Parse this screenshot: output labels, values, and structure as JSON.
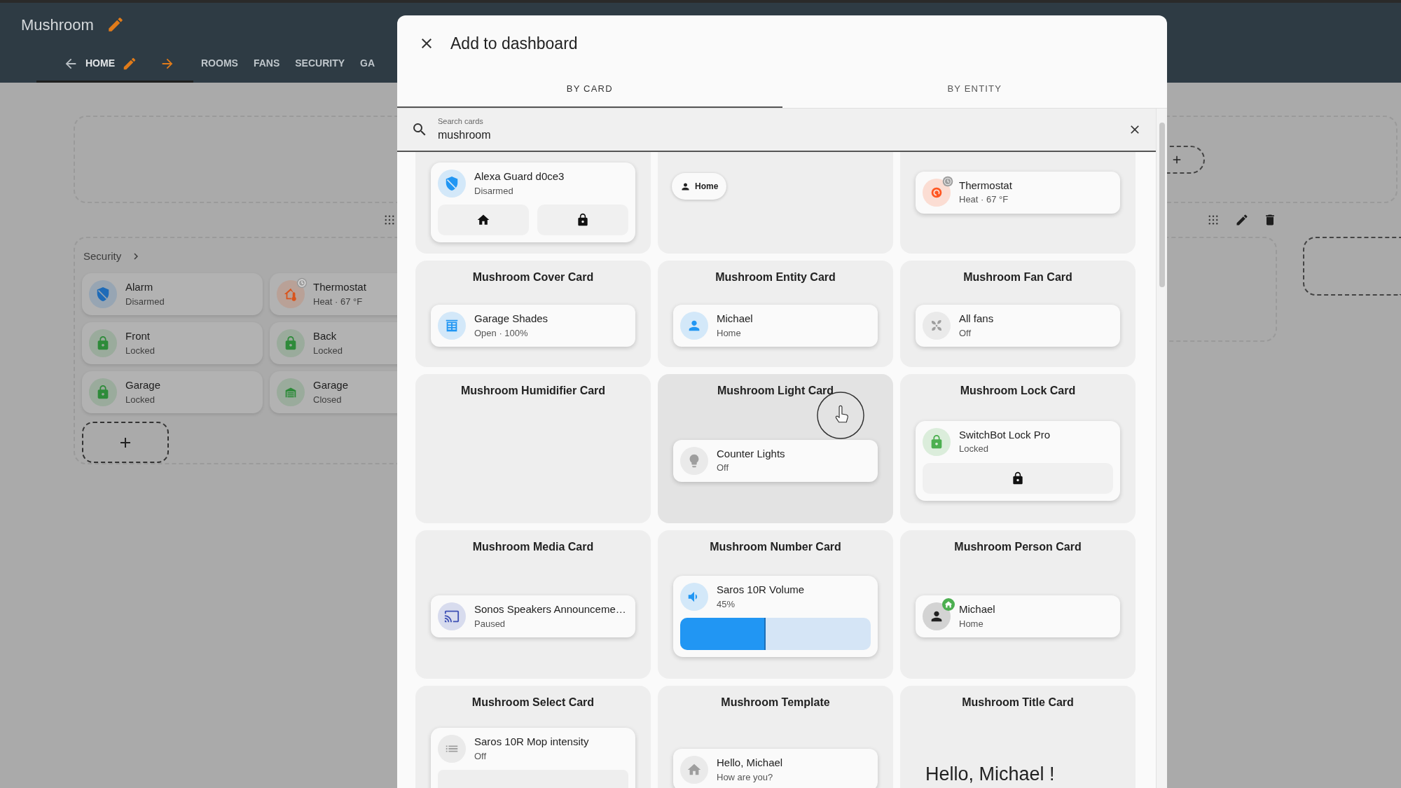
{
  "header": {
    "title": "Mushroom"
  },
  "view_tabs": [
    {
      "label": "HOME",
      "selected": true
    },
    {
      "label": "ROOMS",
      "selected": false
    },
    {
      "label": "FANS",
      "selected": false
    },
    {
      "label": "SECURITY",
      "selected": false
    },
    {
      "label": "GA",
      "selected": false
    }
  ],
  "dashboard": {
    "section_title": "Security",
    "tiles": [
      {
        "kind": "alarm",
        "name": "Alarm",
        "state": "Disarmed",
        "color": "#1e6bb8"
      },
      {
        "kind": "climate",
        "name": "Thermostat",
        "state": "Heat · 67 °F",
        "color": "#d9541c"
      },
      {
        "kind": "lock",
        "name": "Front",
        "state": "Locked",
        "color": "#2e8b3a"
      },
      {
        "kind": "lock",
        "name": "Back",
        "state": "Locked",
        "color": "#2e8b3a"
      },
      {
        "kind": "lock",
        "name": "Garage",
        "state": "Locked",
        "color": "#2e8b3a"
      },
      {
        "kind": "garage",
        "name": "Garage",
        "state": "Closed",
        "color": "#2e8b3a"
      }
    ]
  },
  "dialog": {
    "title": "Add to dashboard",
    "tabs": [
      {
        "label": "BY CARD",
        "selected": true
      },
      {
        "label": "BY ENTITY",
        "selected": false
      }
    ],
    "search": {
      "label": "Search cards",
      "value": "mushroom"
    },
    "cards": [
      {
        "kind": "alarm",
        "highlighted": false,
        "name": "Alexa Guard d0ce3",
        "state": "Disarmed",
        "color": "#2196f3"
      },
      {
        "kind": "chips",
        "highlighted": false,
        "name": "Home"
      },
      {
        "kind": "climate",
        "highlighted": false,
        "name": "Thermostat",
        "state": "Heat · 67 °F",
        "color": "#ff5722"
      },
      {
        "kind": "cover",
        "highlighted": false,
        "title": "Mushroom Cover Card",
        "name": "Garage Shades",
        "state": "Open · 100%",
        "color": "#2196f3"
      },
      {
        "kind": "entity",
        "highlighted": false,
        "title": "Mushroom Entity Card",
        "name": "Michael",
        "state": "Home",
        "color": "#2196f3"
      },
      {
        "kind": "fan",
        "highlighted": false,
        "title": "Mushroom Fan Card",
        "name": "All fans",
        "state": "Off",
        "color": "#9e9e9e"
      },
      {
        "kind": "humidifier",
        "highlighted": false,
        "title": "Mushroom Humidifier Card"
      },
      {
        "kind": "light",
        "highlighted": true,
        "title": "Mushroom Light Card",
        "name": "Counter Lights",
        "state": "Off",
        "color": "#9e9e9e"
      },
      {
        "kind": "lock",
        "highlighted": false,
        "title": "Mushroom Lock Card",
        "name": "SwitchBot Lock Pro",
        "state": "Locked",
        "color": "#4caf50"
      },
      {
        "kind": "media",
        "highlighted": false,
        "title": "Mushroom Media Card",
        "name": "Sonos Speakers Announceme…",
        "state": "Paused",
        "color": "#3f51b5"
      },
      {
        "kind": "number",
        "highlighted": false,
        "title": "Mushroom Number Card",
        "name": "Saros 10R Volume",
        "state": "45%",
        "color": "#2196f3",
        "level": 0.45
      },
      {
        "kind": "person",
        "highlighted": false,
        "title": "Mushroom Person Card",
        "name": "Michael",
        "state": "Home",
        "color": "#212121"
      },
      {
        "kind": "select",
        "highlighted": false,
        "title": "Mushroom Select Card",
        "name": "Saros 10R Mop intensity",
        "state": "Off",
        "color": "#9e9e9e"
      },
      {
        "kind": "template",
        "highlighted": false,
        "title": "Mushroom Template",
        "name": "Hello, Michael",
        "state": "How are you?",
        "color": "#9e9e9e"
      },
      {
        "kind": "title",
        "highlighted": false,
        "title": "Mushroom Title Card",
        "name": "Hello, Michael !"
      }
    ]
  }
}
